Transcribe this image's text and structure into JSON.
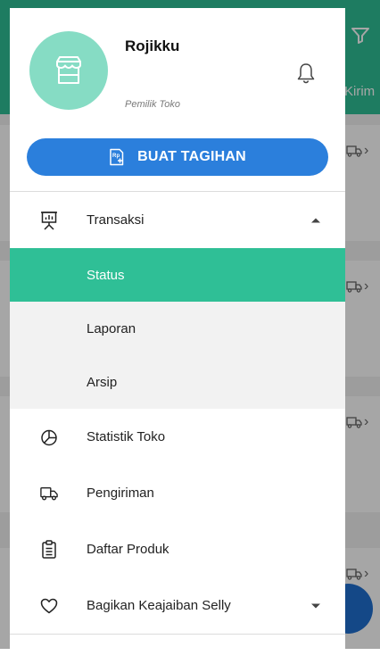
{
  "background": {
    "tab_text": "Kirim",
    "accent": "#2fbf96",
    "fab_color": "#1f6fd0"
  },
  "profile": {
    "name": "Rojikku",
    "role": "Pemilik Toko",
    "avatar_icon": "store-icon",
    "bell_icon": "bell-icon"
  },
  "create_bill_button": {
    "label": "BUAT TAGIHAN",
    "icon": "receipt-add-icon"
  },
  "menu": {
    "transaksi": {
      "label": "Transaksi",
      "icon": "presentation-chart-icon",
      "expanded": true
    },
    "sub_items": [
      {
        "label": "Status",
        "active": true
      },
      {
        "label": "Laporan",
        "active": false
      },
      {
        "label": "Arsip",
        "active": false
      }
    ],
    "statistik": {
      "label": "Statistik Toko",
      "icon": "pie-chart-icon"
    },
    "pengiriman": {
      "label": "Pengiriman",
      "icon": "truck-icon"
    },
    "daftar_produk": {
      "label": "Daftar Produk",
      "icon": "clipboard-icon"
    },
    "bagikan": {
      "label": "Bagikan Keajaiban Selly",
      "icon": "heart-icon",
      "expanded": false
    }
  },
  "colors": {
    "accent": "#2fbf96",
    "button": "#2b7fdc",
    "avatar_bg": "#86dcc4"
  }
}
